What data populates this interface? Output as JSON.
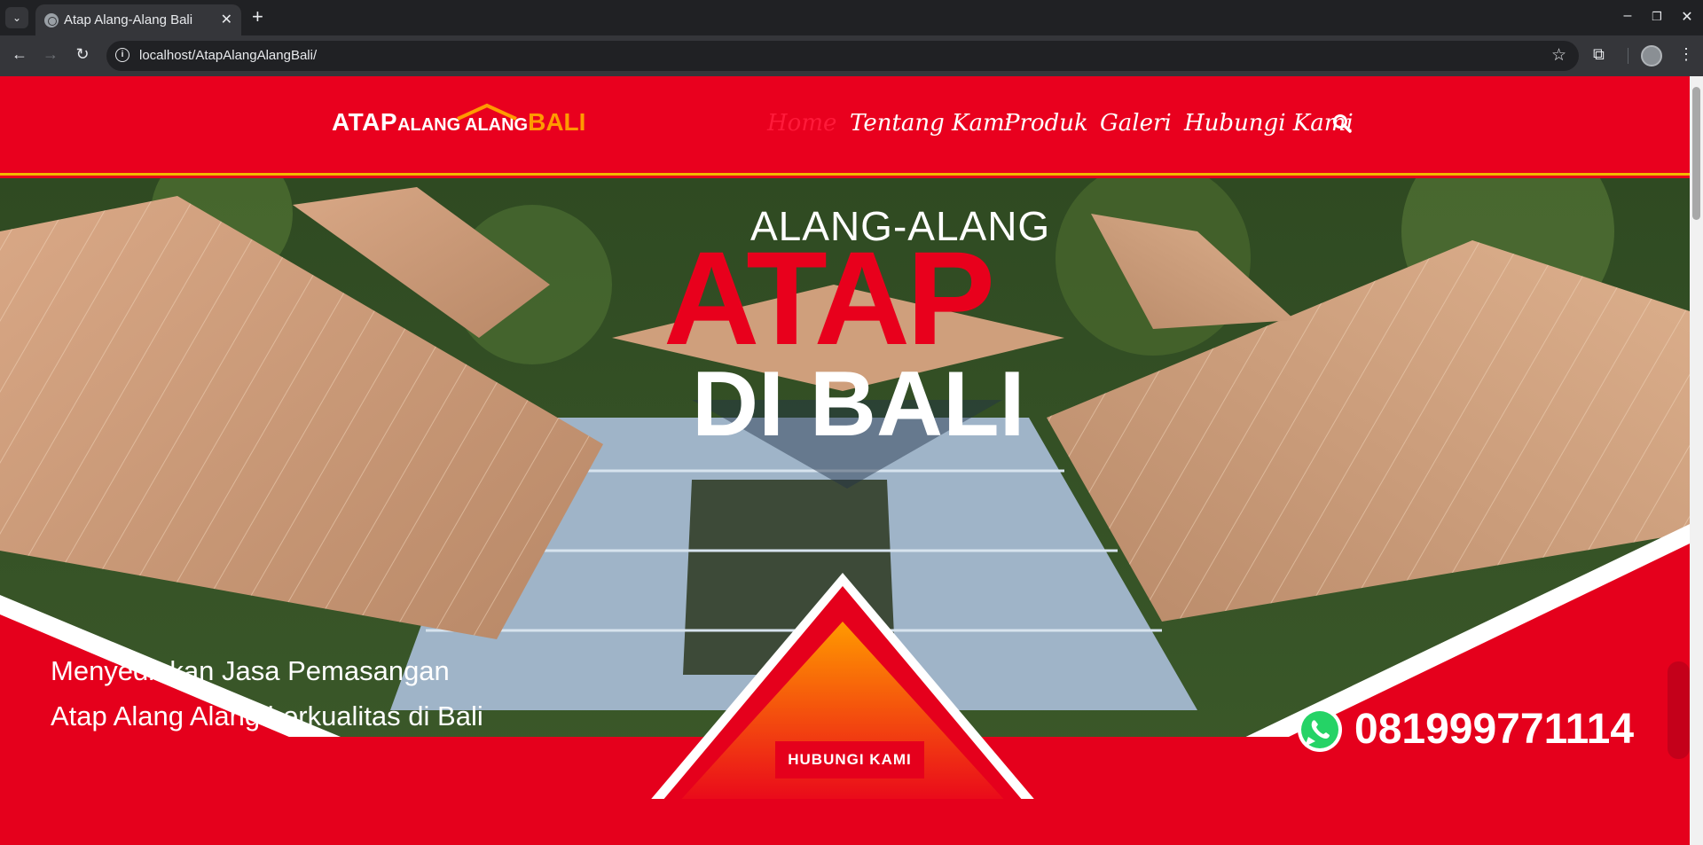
{
  "browser": {
    "tab_title": "Atap Alang-Alang Bali",
    "url": "localhost/AtapAlangAlangBali/"
  },
  "site": {
    "logo": {
      "part1": "ATAP",
      "part2": "ALANG ALANG",
      "part3": "BALI"
    },
    "menu": [
      {
        "label": "Home",
        "active": true
      },
      {
        "label": "Tentang Kami",
        "active": false
      },
      {
        "label": "Produk",
        "active": false
      },
      {
        "label": "Galeri",
        "active": false
      },
      {
        "label": "Hubungi Kami",
        "active": false
      }
    ],
    "colors": {
      "primary": "#e9001e",
      "accent": "#f3b800",
      "logo_accent": "#ff9a00"
    }
  },
  "hero": {
    "line1": "ALANG-ALANG",
    "line2": "ATAP",
    "line3": "DI BALI",
    "tagline": "Menyediakan Jasa Pemasangan Atap Alang Alang berkualitas di Bali",
    "cta_label": "HUBUNGI KAMI",
    "phone": "081999771114"
  },
  "icons": {
    "search": "search-icon",
    "whatsapp": "whatsapp-icon",
    "back": "back-arrow-icon",
    "forward": "forward-arrow-icon",
    "reload": "reload-icon",
    "bookmark": "star-icon",
    "extensions": "puzzle-icon"
  }
}
